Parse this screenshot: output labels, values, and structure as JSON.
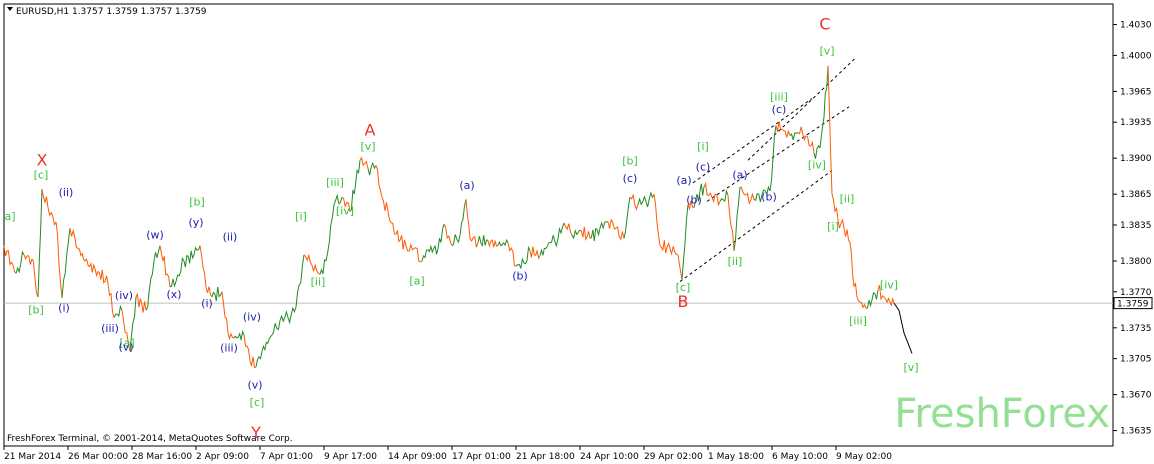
{
  "header": {
    "symbol_line": "EURUSD,H1  1.3757 1.3759 1.3757 1.3759"
  },
  "footer": {
    "copyright": "FreshForex Terminal, © 2001-2014, MetaQuotes Software Corp."
  },
  "watermark": {
    "text": "FreshForex"
  },
  "colors": {
    "bull": "#228b22",
    "bear": "#ff5a00",
    "wave_major": "#e8332a",
    "wave_green": "#39c33a",
    "wave_blue": "#2020b0",
    "watermark": "#93e093"
  },
  "chart_data": {
    "type": "line",
    "title": "EURUSD,H1",
    "ylim": [
      1.362,
      1.405
    ],
    "y_ticks": [
      1.403,
      1.4,
      1.3965,
      1.3935,
      1.39,
      1.3865,
      1.3835,
      1.38,
      1.377,
      1.3735,
      1.3705,
      1.367,
      1.3635
    ],
    "y_tick_labels": [
      "1.4030",
      "1.4000",
      "1.3965",
      "1.3935",
      "1.3900",
      "1.3865",
      "1.3835",
      "1.3800",
      "1.3770",
      "1.3735",
      "1.3705",
      "1.3670",
      "1.3635"
    ],
    "x_ticks": [
      "21 Mar 2014",
      "26 Mar 00:00",
      "28 Mar 16:00",
      "2 Apr 09:00",
      "7 Apr 01:00",
      "9 Apr 17:00",
      "14 Apr 09:00",
      "17 Apr 01:00",
      "21 Apr 18:00",
      "24 Apr 10:00",
      "29 Apr 02:00",
      "1 May 18:00",
      "6 May 10:00",
      "9 May 02:00"
    ],
    "current_price": {
      "label": "1.3759",
      "value": 1.3759
    },
    "series": [
      {
        "values": [
          [
            0,
            1.3815
          ],
          [
            12,
            1.3788
          ],
          [
            20,
            1.3806
          ],
          [
            28,
            1.3802
          ],
          [
            34,
            1.3765
          ],
          [
            38,
            1.387
          ],
          [
            44,
            1.3852
          ],
          [
            52,
            1.3838
          ],
          [
            58,
            1.3764
          ],
          [
            66,
            1.3832
          ],
          [
            74,
            1.3812
          ],
          [
            84,
            1.3796
          ],
          [
            94,
            1.379
          ],
          [
            104,
            1.3778
          ],
          [
            110,
            1.3745
          ],
          [
            118,
            1.3752
          ],
          [
            126,
            1.3712
          ],
          [
            132,
            1.3765
          ],
          [
            142,
            1.3752
          ],
          [
            150,
            1.38
          ],
          [
            156,
            1.3815
          ],
          [
            166,
            1.3775
          ],
          [
            172,
            1.378
          ],
          [
            180,
            1.38
          ],
          [
            190,
            1.3806
          ],
          [
            196,
            1.3815
          ],
          [
            202,
            1.3775
          ],
          [
            208,
            1.3765
          ],
          [
            218,
            1.377
          ],
          [
            224,
            1.373
          ],
          [
            230,
            1.3725
          ],
          [
            240,
            1.3728
          ],
          [
            246,
            1.3703
          ],
          [
            252,
            1.3697
          ],
          [
            258,
            1.3712
          ],
          [
            268,
            1.3728
          ],
          [
            276,
            1.3742
          ],
          [
            284,
            1.3745
          ],
          [
            292,
            1.3755
          ],
          [
            300,
            1.3806
          ],
          [
            308,
            1.3796
          ],
          [
            316,
            1.3787
          ],
          [
            322,
            1.38
          ],
          [
            330,
            1.3855
          ],
          [
            338,
            1.3862
          ],
          [
            346,
            1.3848
          ],
          [
            356,
            1.3898
          ],
          [
            364,
            1.389
          ],
          [
            372,
            1.3893
          ],
          [
            378,
            1.3862
          ],
          [
            384,
            1.3848
          ],
          [
            392,
            1.3826
          ],
          [
            402,
            1.3815
          ],
          [
            410,
            1.3812
          ],
          [
            418,
            1.38
          ],
          [
            424,
            1.3811
          ],
          [
            434,
            1.3812
          ],
          [
            440,
            1.3836
          ],
          [
            448,
            1.3815
          ],
          [
            456,
            1.3825
          ],
          [
            462,
            1.386
          ],
          [
            466,
            1.3822
          ],
          [
            474,
            1.3818
          ],
          [
            484,
            1.382
          ],
          [
            494,
            1.3815
          ],
          [
            504,
            1.3818
          ],
          [
            512,
            1.3795
          ],
          [
            520,
            1.3798
          ],
          [
            526,
            1.381
          ],
          [
            536,
            1.3805
          ],
          [
            546,
            1.3818
          ],
          [
            554,
            1.3822
          ],
          [
            560,
            1.3837
          ],
          [
            568,
            1.3825
          ],
          [
            576,
            1.383
          ],
          [
            586,
            1.3822
          ],
          [
            596,
            1.3832
          ],
          [
            604,
            1.3838
          ],
          [
            612,
            1.3832
          ],
          [
            620,
            1.3822
          ],
          [
            626,
            1.3862
          ],
          [
            634,
            1.3855
          ],
          [
            642,
            1.3858
          ],
          [
            650,
            1.3865
          ],
          [
            656,
            1.3815
          ],
          [
            666,
            1.3812
          ],
          [
            674,
            1.3806
          ],
          [
            678,
            1.3782
          ],
          [
            684,
            1.3855
          ],
          [
            690,
            1.3852
          ],
          [
            696,
            1.3868
          ],
          [
            700,
            1.3872
          ],
          [
            708,
            1.3862
          ],
          [
            716,
            1.3858
          ],
          [
            724,
            1.3864
          ],
          [
            730,
            1.381
          ],
          [
            736,
            1.3872
          ],
          [
            742,
            1.3864
          ],
          [
            750,
            1.386
          ],
          [
            758,
            1.3865
          ],
          [
            766,
            1.3868
          ],
          [
            772,
            1.3932
          ],
          [
            778,
            1.3928
          ],
          [
            786,
            1.3922
          ],
          [
            794,
            1.3925
          ],
          [
            802,
            1.3922
          ],
          [
            810,
            1.3905
          ],
          [
            816,
            1.391
          ],
          [
            820,
            1.394
          ],
          [
            824,
            1.399
          ],
          [
            828,
            1.3865
          ],
          [
            834,
            1.384
          ],
          [
            840,
            1.3832
          ],
          [
            846,
            1.3818
          ],
          [
            850,
            1.3775
          ],
          [
            856,
            1.376
          ],
          [
            862,
            1.3754
          ],
          [
            868,
            1.3762
          ],
          [
            874,
            1.3772
          ],
          [
            880,
            1.3765
          ],
          [
            886,
            1.376
          ],
          [
            890,
            1.3759
          ]
        ]
      },
      {
        "values": [
          [
            890,
            1.3759
          ],
          [
            895,
            1.3752
          ],
          [
            900,
            1.373
          ],
          [
            908,
            1.371
          ]
        ]
      }
    ],
    "annotations": [
      {
        "text": "X",
        "x": 38,
        "y": 1.3893,
        "color": "wave_major",
        "size": "large"
      },
      {
        "text": "A",
        "x": 366,
        "y": 1.3922,
        "color": "wave_major",
        "size": "large"
      },
      {
        "text": "B",
        "x": 679,
        "y": 1.3755,
        "color": "wave_major",
        "size": "large"
      },
      {
        "text": "C",
        "x": 821,
        "y": 1.4025,
        "color": "wave_major",
        "size": "large"
      },
      {
        "text": "Y",
        "x": 252,
        "y": 1.3628,
        "color": "wave_major",
        "size": "large"
      },
      {
        "text": "a]",
        "x": 6,
        "y": 1.384,
        "color": "wave_green"
      },
      {
        "text": "[b]",
        "x": 32,
        "y": 1.3749,
        "color": "wave_green"
      },
      {
        "text": "[c]",
        "x": 37,
        "y": 1.388,
        "color": "wave_green"
      },
      {
        "text": "[a]",
        "x": 123,
        "y": 1.3717,
        "color": "wave_green"
      },
      {
        "text": "[b]",
        "x": 193,
        "y": 1.3854,
        "color": "wave_green"
      },
      {
        "text": "[c]",
        "x": 253,
        "y": 1.3659,
        "color": "wave_green"
      },
      {
        "text": "[i]",
        "x": 297,
        "y": 1.384,
        "color": "wave_green"
      },
      {
        "text": "[ii]",
        "x": 314,
        "y": 1.3776,
        "color": "wave_green"
      },
      {
        "text": "[iii]",
        "x": 331,
        "y": 1.3873,
        "color": "wave_green"
      },
      {
        "text": "[iv]",
        "x": 341,
        "y": 1.3845,
        "color": "wave_green"
      },
      {
        "text": "[v]",
        "x": 364,
        "y": 1.3908,
        "color": "wave_green"
      },
      {
        "text": "[a]",
        "x": 413,
        "y": 1.3777,
        "color": "wave_green"
      },
      {
        "text": "[b]",
        "x": 626,
        "y": 1.3894,
        "color": "wave_green"
      },
      {
        "text": "[c]",
        "x": 679,
        "y": 1.3771,
        "color": "wave_green"
      },
      {
        "text": "[i]",
        "x": 699,
        "y": 1.3908,
        "color": "wave_green"
      },
      {
        "text": "[ii]",
        "x": 731,
        "y": 1.3796,
        "color": "wave_green"
      },
      {
        "text": "[iii]",
        "x": 775,
        "y": 1.3956,
        "color": "wave_green"
      },
      {
        "text": "[iv]",
        "x": 813,
        "y": 1.389,
        "color": "wave_green"
      },
      {
        "text": "[v]",
        "x": 823,
        "y": 1.4001,
        "color": "wave_green"
      },
      {
        "text": "[i]",
        "x": 829,
        "y": 1.383,
        "color": "wave_green"
      },
      {
        "text": "[ii]",
        "x": 843,
        "y": 1.3857,
        "color": "wave_green"
      },
      {
        "text": "[iii]",
        "x": 854,
        "y": 1.3738,
        "color": "wave_green"
      },
      {
        "text": "[iv]",
        "x": 885,
        "y": 1.3773,
        "color": "wave_green"
      },
      {
        "text": "[v]",
        "x": 907,
        "y": 1.3693,
        "color": "wave_green"
      },
      {
        "text": "(ii)",
        "x": 62,
        "y": 1.3863,
        "color": "wave_blue"
      },
      {
        "text": "(i)",
        "x": 60,
        "y": 1.3751,
        "color": "wave_blue"
      },
      {
        "text": "(iii)",
        "x": 106,
        "y": 1.3731,
        "color": "wave_blue"
      },
      {
        "text": "(iv)",
        "x": 120,
        "y": 1.3763,
        "color": "wave_blue"
      },
      {
        "text": "(v)",
        "x": 122,
        "y": 1.3713,
        "color": "wave_blue"
      },
      {
        "text": "(w)",
        "x": 151,
        "y": 1.3822,
        "color": "wave_blue"
      },
      {
        "text": "(x)",
        "x": 170,
        "y": 1.3764,
        "color": "wave_blue"
      },
      {
        "text": "(y)",
        "x": 192,
        "y": 1.3834,
        "color": "wave_blue"
      },
      {
        "text": "(i)",
        "x": 203,
        "y": 1.3755,
        "color": "wave_blue"
      },
      {
        "text": "(ii)",
        "x": 226,
        "y": 1.382,
        "color": "wave_blue"
      },
      {
        "text": "(iii)",
        "x": 225,
        "y": 1.3712,
        "color": "wave_blue"
      },
      {
        "text": "(iv)",
        "x": 248,
        "y": 1.3742,
        "color": "wave_blue"
      },
      {
        "text": "(v)",
        "x": 251,
        "y": 1.3676,
        "color": "wave_blue"
      },
      {
        "text": "(a)",
        "x": 463,
        "y": 1.387,
        "color": "wave_blue"
      },
      {
        "text": "(b)",
        "x": 516,
        "y": 1.3782,
        "color": "wave_blue"
      },
      {
        "text": "(c)",
        "x": 626,
        "y": 1.3877,
        "color": "wave_blue"
      },
      {
        "text": "(a)",
        "x": 680,
        "y": 1.3875,
        "color": "wave_blue"
      },
      {
        "text": "(b)",
        "x": 690,
        "y": 1.3856,
        "color": "wave_blue"
      },
      {
        "text": "(c)",
        "x": 699,
        "y": 1.3888,
        "color": "wave_blue"
      },
      {
        "text": "(a)",
        "x": 736,
        "y": 1.388,
        "color": "wave_blue"
      },
      {
        "text": "(b)",
        "x": 765,
        "y": 1.3859,
        "color": "wave_blue"
      },
      {
        "text": "(c)",
        "x": 775,
        "y": 1.3944,
        "color": "wave_blue"
      }
    ],
    "channel_lines": [
      [
        [
          676,
          1.378
        ],
        [
          828,
          1.3888
        ]
      ],
      [
        [
          703,
          1.3858
        ],
        [
          845,
          1.395
        ]
      ],
      [
        [
          689,
          1.3876
        ],
        [
          808,
          1.3958
        ]
      ],
      [
        [
          744,
          1.3898
        ],
        [
          851,
          1.3997
        ]
      ]
    ]
  }
}
